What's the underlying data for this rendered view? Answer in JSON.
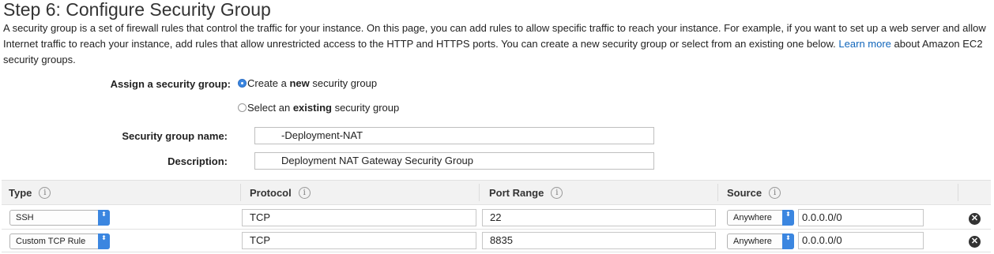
{
  "page": {
    "title": "Step 6: Configure Security Group",
    "intro_text": "A security group is a set of firewall rules that control the traffic for your instance. On this page, you can add rules to allow specific traffic to reach your instance. For example, if you want to set up a web server and allow Internet traffic to reach your instance, add rules that allow unrestricted access to the HTTP and HTTPS ports. You can create a new security group or select from an existing one below.",
    "learn_more_link": "Learn more",
    "intro_suffix": "about Amazon EC2 security groups."
  },
  "assign": {
    "label": "Assign a security group:",
    "options": [
      {
        "prefix": "Create a ",
        "bold": "new",
        "suffix": " security group",
        "selected": true
      },
      {
        "prefix": "Select an ",
        "bold": "existing",
        "suffix": " security group",
        "selected": false
      }
    ]
  },
  "form": {
    "name_label": "Security group name:",
    "name_value": "-Deployment-NAT",
    "description_label": "Description:",
    "description_value": "Deployment NAT Gateway Security Group"
  },
  "rules_table": {
    "columns": [
      "Type",
      "Protocol",
      "Port Range",
      "Source"
    ],
    "info_glyph": "i",
    "rows": [
      {
        "type": "SSH",
        "protocol": "TCP",
        "port_range": "22",
        "source_select": "Anywhere",
        "source_cidr": "0.0.0.0/0"
      },
      {
        "type": "Custom TCP Rule",
        "protocol": "TCP",
        "port_range": "8835",
        "source_select": "Anywhere",
        "source_cidr": "0.0.0.0/0"
      }
    ],
    "remove_glyph": "✕"
  },
  "icons": {
    "select_arrow": "⬍",
    "info": "info-icon",
    "remove": "remove-rule-icon"
  },
  "colors": {
    "accent": "#3b86e0",
    "link": "#1166bb",
    "header_bg": "#f2f2f2"
  }
}
